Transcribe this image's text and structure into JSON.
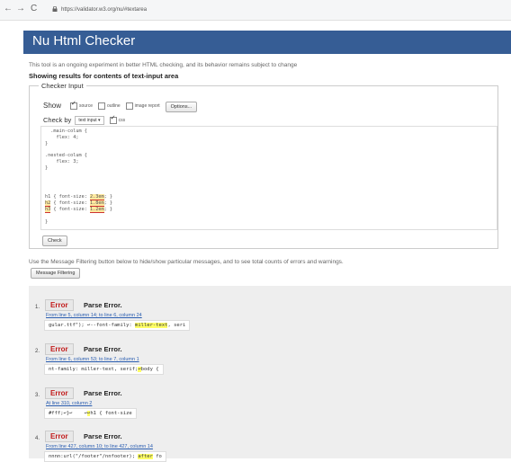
{
  "browser": {
    "back": "←",
    "forward": "→",
    "reload": "C",
    "url": "https://validator.w3.org/nu/#textarea"
  },
  "page": {
    "title": "Nu Html Checker",
    "intro": "This tool is an ongoing experiment in better HTML checking, and its behavior remains subject to change",
    "results_heading": "Showing results for contents of text-input area"
  },
  "checker": {
    "legend": "Checker Input",
    "show_label": "Show",
    "show_options": [
      {
        "label": "source",
        "checked": true
      },
      {
        "label": "outline",
        "checked": false
      },
      {
        "label": "image report",
        "checked": false
      }
    ],
    "options_button": "Options...",
    "check_by_label": "Check by",
    "check_by_value": "text input",
    "css_label": "css",
    "css_checked": true,
    "code": {
      "l1": "  .main-colum {",
      "l2": "    flex: 4;",
      "l3": "}",
      "l4": ".nested-colum {",
      "l5": "    flex: 3;",
      "l6": "}",
      "l7": "h1 { font-size: ",
      "l7m": "2.3em",
      "l7e": "; }",
      "l8a": "h2",
      "l8b": " { font-size: ",
      "l8m": "1.8em",
      "l8e": "; }",
      "l9a": "h3",
      "l9b": " { font-size: ",
      "l9m": "1.2em",
      "l9e": "; }",
      "l10": "}"
    },
    "check_button": "Check"
  },
  "filter": {
    "text": "Use the Message Filtering button below to hide/show particular messages, and to see total counts of errors and warnings.",
    "button": "Message Filtering"
  },
  "messages": [
    {
      "num": "1.",
      "type": "Error",
      "title": "Parse Error.",
      "location": "From line 5, column 14; to line 6, column 24",
      "pre": "gular.ttf\"); ",
      "arrow": "↩",
      "mid": "--font-family: ",
      "hl": "miller-text",
      "post": ", seri"
    },
    {
      "num": "2.",
      "type": "Error",
      "title": "Parse Error.",
      "location": "From line 6, column 53; to line 7, column 1",
      "pre": "nt-family: miller-text, serif;",
      "arrow": "",
      "mid": "",
      "hl": "↩",
      "post": "body {"
    },
    {
      "num": "3.",
      "type": "Error",
      "title": "Parse Error.",
      "location": "At line 310, column 2",
      "pre": "#fff;↩}↩    ↩",
      "arrow": "",
      "mid": "",
      "hl": "↩",
      "post": "h1 { font-size"
    },
    {
      "num": "4.",
      "type": "Error",
      "title": "Parse Error.",
      "location": "From line 427, column 10; to line 427, column 14",
      "pre": "nnnn:url(\"/footer\"/nnfooter); ",
      "arrow": "",
      "mid": "",
      "hl": "after",
      "post": " fo"
    }
  ]
}
